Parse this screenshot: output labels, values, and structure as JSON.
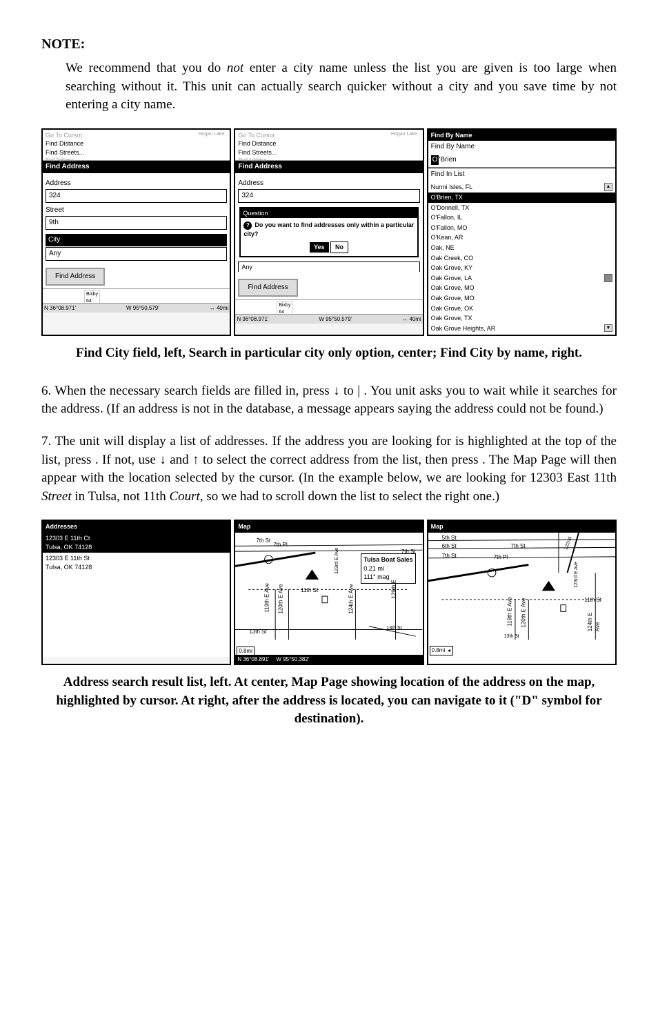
{
  "note": {
    "heading": "NOTE:",
    "body_pre": "We recommend that you do ",
    "body_em": "not",
    "body_post": " enter a city name unless the list you are given is too large when searching without it. This unit can actually search quicker without a city and you save time by not entering a city name."
  },
  "figure1": {
    "panelA": {
      "top_items": [
        "Go To Cursor",
        "Find Distance",
        "Find Streets...",
        "Find Address..."
      ],
      "lake": "Hogan Lake",
      "title": "Find Address",
      "address_label": "Address",
      "address_value": "324",
      "street_label": "Street",
      "street_value": "9th",
      "city_label": "City",
      "city_value": "Any",
      "find_btn": "Find Address",
      "road": "Bixby\n64",
      "coords_n": "N    36°08.971'",
      "coords_w": "W    95°50.579'",
      "coords_scale": "40mi"
    },
    "panelB": {
      "title": "Find Address",
      "address_label": "Address",
      "address_value": "324",
      "dialog_title": "Question",
      "dialog_text": "Do you want to find addresses only within a particular city?",
      "yes": "Yes",
      "no": "No",
      "city_value": "Any",
      "find_btn": "Find Address"
    },
    "panelC": {
      "title": "Find By Name",
      "subtext": "Find By Name",
      "input": "O'Brien",
      "list_title": "Find In List",
      "items": [
        {
          "text": "Nurmi Isles, FL",
          "sel": false,
          "scroll": "up"
        },
        {
          "text": "O'Brien, TX",
          "sel": true
        },
        {
          "text": "O'Donnell, TX",
          "sel": false
        },
        {
          "text": "O'Fallon, IL",
          "sel": false
        },
        {
          "text": "O'Fallon, MO",
          "sel": false
        },
        {
          "text": "O'Kean, AR",
          "sel": false
        },
        {
          "text": "Oak, NE",
          "sel": false
        },
        {
          "text": "Oak Creek, CO",
          "sel": false
        },
        {
          "text": "Oak Grove, KY",
          "sel": false
        },
        {
          "text": "Oak Grove, LA",
          "sel": false,
          "scroll": "mid"
        },
        {
          "text": "Oak Grove, MO",
          "sel": false
        },
        {
          "text": "Oak Grove, MO",
          "sel": false
        },
        {
          "text": "Oak Grove, OK",
          "sel": false
        },
        {
          "text": "Oak Grove, TX",
          "sel": false
        },
        {
          "text": "Oak Grove Heights, AR",
          "sel": false,
          "scroll": "down"
        }
      ]
    },
    "caption": "Find City field, left, Search in particular city only option, center; Find City by name, right."
  },
  "step6": {
    "text": "6. When the necessary search fields are filled in, press ↓ to            |       . You unit asks you to wait while it searches for the address. (If an address is not in the database, a message appears saying the address could not be found.)"
  },
  "step7": {
    "pre": "7. The unit will display a list of addresses. If the address you are looking for is highlighted at the top of the list, press       . If not, use ↓ and ↑ to select the correct address from the list, then press       . The Map Page will then appear with the location selected by the cursor. (In the example below, we are looking for 12303 East 11th ",
    "em1": "Street",
    "mid": " in Tulsa, not 11th ",
    "em2": "Court",
    "post": ", so we had to scroll down the list to select the right one.)"
  },
  "figure2": {
    "panelA": {
      "title": "Addresses",
      "items": [
        {
          "text": "12303 E 11th Ct\nTulsa, OK  74128",
          "sel": true
        },
        {
          "text": "12303 E 11th St\nTulsa, OK  74128",
          "sel": false
        }
      ]
    },
    "panelB": {
      "title": "Map",
      "label_box": "Tulsa Boat Sales\n0.21 mi\n111° mag",
      "streets": [
        "7th St",
        "7th Pl",
        "7th St",
        "11th St",
        "13th St",
        "119th E Ave",
        "120th E Ave",
        "123rd E Ave",
        "124th E Ave",
        "129th E"
      ],
      "scale": "0.8mi",
      "coords_n": "N   36°08.891'",
      "coords_w": "W   95°50.382'"
    },
    "panelC": {
      "title": "Map",
      "streets": [
        "5th St",
        "6th St",
        "7th St",
        "7th St",
        "7th Pl",
        "11th St",
        "13th St",
        "119th E Ave",
        "120th E Ave",
        "122nd",
        "123rd E Ave",
        "124th E Ave"
      ],
      "scale": "0.8mi"
    },
    "caption": "Address search result list, left. At center, Map Page showing location of the address on the map, highlighted by cursor. At right, after the address is located, you can navigate to it (\"D\" symbol for destination)."
  }
}
